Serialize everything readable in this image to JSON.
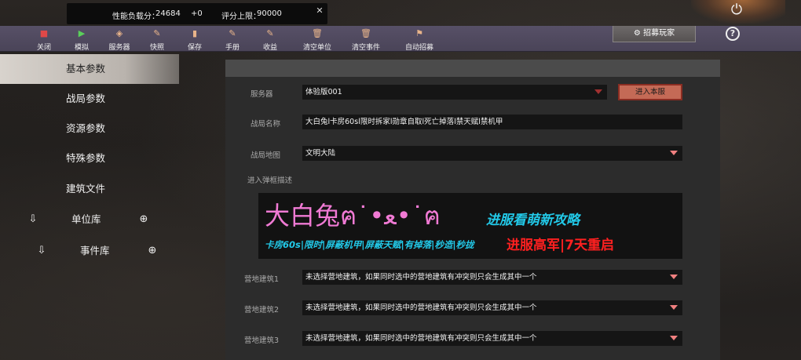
{
  "topstats": {
    "perf_label": "性能负载分：",
    "perf_value": "24684",
    "perf_delta": "+0",
    "score_label": "评分上限：",
    "score_value": "90000"
  },
  "toolbar": {
    "items": [
      {
        "label": "关闭",
        "icon": "stop-icon",
        "color": "#e04848"
      },
      {
        "label": "模拟",
        "icon": "play-icon",
        "color": "#5ad05a"
      },
      {
        "label": "服务器",
        "icon": "box-icon",
        "color": "#e8b48a"
      },
      {
        "label": "快照",
        "icon": "edit-icon",
        "color": "#e8b48a"
      },
      {
        "label": "保存",
        "icon": "save-icon",
        "color": "#e8b48a"
      },
      {
        "label": "手册",
        "icon": "manual-icon",
        "color": "#e8b48a"
      },
      {
        "label": "收益",
        "icon": "income-icon",
        "color": "#e8b48a"
      },
      {
        "label": "清空单位",
        "icon": "trash-icon",
        "color": "#e8b48a"
      },
      {
        "label": "清空事件",
        "icon": "trash-icon",
        "color": "#e8b48a"
      },
      {
        "label": "自动招募",
        "icon": "flag-icon",
        "color": "#e8b48a"
      }
    ],
    "recruit_label": "招募玩家",
    "help_label": "?"
  },
  "sidebar": {
    "items": [
      {
        "label": "基本参数"
      },
      {
        "label": "战局参数"
      },
      {
        "label": "资源参数"
      },
      {
        "label": "特殊参数"
      },
      {
        "label": "建筑文件"
      }
    ],
    "unit_lib_label": "单位库",
    "event_lib_label": "事件库"
  },
  "form": {
    "server_label": "服务器",
    "server_value": "体验版001",
    "enter_button": "进入本服",
    "name_label": "战局名称",
    "name_value": "大白兔l卡房60sl限时拆家l勋章自取l死亡掉落l禁天赋l禁机甲",
    "map_label": "战局地图",
    "map_value": "文明大陆",
    "desc_label": "进入弹框描述",
    "desc_big": "大白兔ฅ˙•ﻌ•˙ฅ",
    "desc_side": "进服看萌新攻略",
    "desc_line2": "卡房60s|限时|屏蔽机甲|屏蔽天赋|有掉落|秒造|秒拢",
    "desc_red": "进服高军|7天重启",
    "camp_buildings": [
      {
        "label": "营地建筑1",
        "value": "未选择营地建筑，如果同时选中的营地建筑有冲突则只会生成其中一个"
      },
      {
        "label": "营地建筑2",
        "value": "未选择营地建筑，如果同时选中的营地建筑有冲突则只会生成其中一个"
      },
      {
        "label": "营地建筑3",
        "value": "未选择营地建筑，如果同时选中的营地建筑有冲突则只会生成其中一个"
      }
    ]
  }
}
